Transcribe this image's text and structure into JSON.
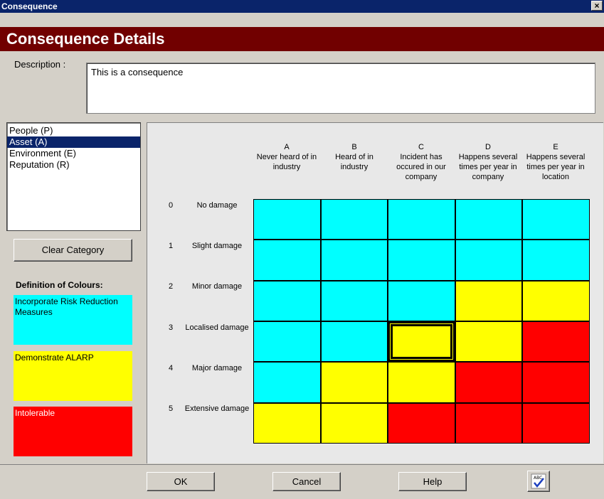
{
  "window": {
    "title": "Consequence",
    "close_label": "×"
  },
  "header": {
    "title": "Consequence Details"
  },
  "description": {
    "label": "Description :",
    "value": "This is a consequence"
  },
  "categories": {
    "items": [
      {
        "label": "People (P)",
        "selected": false
      },
      {
        "label": "Asset (A)",
        "selected": true
      },
      {
        "label": "Environment (E)",
        "selected": false
      },
      {
        "label": "Reputation (R)",
        "selected": false
      }
    ],
    "clear_label": "Clear Category"
  },
  "definitions": {
    "title": "Definition of Colours:",
    "items": [
      {
        "label": "Incorporate Risk Reduction Measures",
        "color": "#00ffff"
      },
      {
        "label": "Demonstrate ALARP",
        "color": "#ffff00"
      },
      {
        "label": "Intolerable",
        "color": "#ff0000"
      }
    ]
  },
  "matrix": {
    "columns": [
      {
        "letter": "A",
        "text": "Never heard of in industry"
      },
      {
        "letter": "B",
        "text": "Heard of in industry"
      },
      {
        "letter": "C",
        "text": "Incident has occured in our company"
      },
      {
        "letter": "D",
        "text": "Happens several times per year in company"
      },
      {
        "letter": "E",
        "text": "Happens several times per year in location"
      }
    ],
    "rows": [
      {
        "num": "0",
        "label": "No damage"
      },
      {
        "num": "1",
        "label": "Slight damage"
      },
      {
        "num": "2",
        "label": "Minor damage"
      },
      {
        "num": "3",
        "label": "Localised damage"
      },
      {
        "num": "4",
        "label": "Major damage"
      },
      {
        "num": "5",
        "label": "Extensive damage"
      }
    ],
    "colors": {
      "c": "#00ffff",
      "y": "#ffff00",
      "r": "#ff0000"
    },
    "cells": [
      [
        "c",
        "c",
        "c",
        "c",
        "c"
      ],
      [
        "c",
        "c",
        "c",
        "c",
        "c"
      ],
      [
        "c",
        "c",
        "c",
        "y",
        "y"
      ],
      [
        "c",
        "c",
        "y",
        "y",
        "r"
      ],
      [
        "c",
        "y",
        "y",
        "r",
        "r"
      ],
      [
        "y",
        "y",
        "r",
        "r",
        "r"
      ]
    ],
    "selected": {
      "row": 3,
      "col": 2
    }
  },
  "footer": {
    "ok": "OK",
    "cancel": "Cancel",
    "help": "Help",
    "spell_icon": "spellcheck-icon"
  }
}
